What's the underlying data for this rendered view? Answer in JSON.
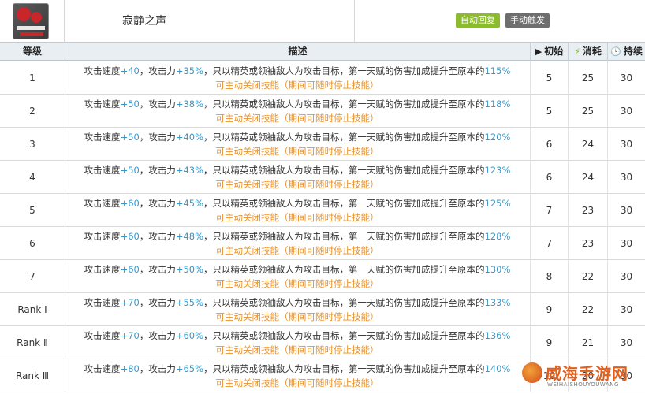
{
  "skill": {
    "name": "寂静之声",
    "tag_auto": "自动回复",
    "tag_manual": "手动触发",
    "icon": "skill-icon"
  },
  "header": {
    "level": "等级",
    "description": "描述",
    "initial": "初始",
    "initial_icon": "play-icon",
    "cost": "消耗",
    "cost_icon": "lightning-icon",
    "duration": "持续",
    "duration_icon": "clock-icon"
  },
  "rows": [
    {
      "level": "1",
      "spd": "+40",
      "atk": "+35%",
      "pct": "115%",
      "init": "5",
      "cost": "25",
      "dur": "30"
    },
    {
      "level": "2",
      "spd": "+50",
      "atk": "+38%",
      "pct": "118%",
      "init": "5",
      "cost": "25",
      "dur": "30"
    },
    {
      "level": "3",
      "spd": "+50",
      "atk": "+40%",
      "pct": "120%",
      "init": "6",
      "cost": "24",
      "dur": "30"
    },
    {
      "level": "4",
      "spd": "+50",
      "atk": "+43%",
      "pct": "123%",
      "init": "6",
      "cost": "24",
      "dur": "30"
    },
    {
      "level": "5",
      "spd": "+60",
      "atk": "+45%",
      "pct": "125%",
      "init": "7",
      "cost": "23",
      "dur": "30"
    },
    {
      "level": "6",
      "spd": "+60",
      "atk": "+48%",
      "pct": "128%",
      "init": "7",
      "cost": "23",
      "dur": "30"
    },
    {
      "level": "7",
      "spd": "+60",
      "atk": "+50%",
      "pct": "130%",
      "init": "8",
      "cost": "22",
      "dur": "30"
    },
    {
      "level": "Rank Ⅰ",
      "spd": "+70",
      "atk": "+55%",
      "pct": "133%",
      "init": "9",
      "cost": "22",
      "dur": "30"
    },
    {
      "level": "Rank Ⅱ",
      "spd": "+70",
      "atk": "+60%",
      "pct": "136%",
      "init": "9",
      "cost": "21",
      "dur": "30"
    },
    {
      "level": "Rank Ⅲ",
      "spd": "+80",
      "atk": "+65%",
      "pct": "140%",
      "init": "10",
      "cost": "20",
      "dur": "30"
    }
  ],
  "desc": {
    "part1": "攻击速度",
    "part2": "，攻击力",
    "part3": "，只以精英或领袖敌人为攻击目标，第一天赋的伤害加成提升至原本的",
    "line2": "可主动关闭技能（期间可随时停止技能）"
  },
  "colors": {
    "value_blue": "#3a98c8",
    "note_orange": "#e8912a",
    "tag_auto": "#8cbc2e",
    "tag_manual": "#6e6e6e",
    "header_bg": "#e9eef3"
  },
  "watermark": {
    "title": "威海手游网",
    "subtitle": "WEIHAISHOUYOUWANG"
  }
}
